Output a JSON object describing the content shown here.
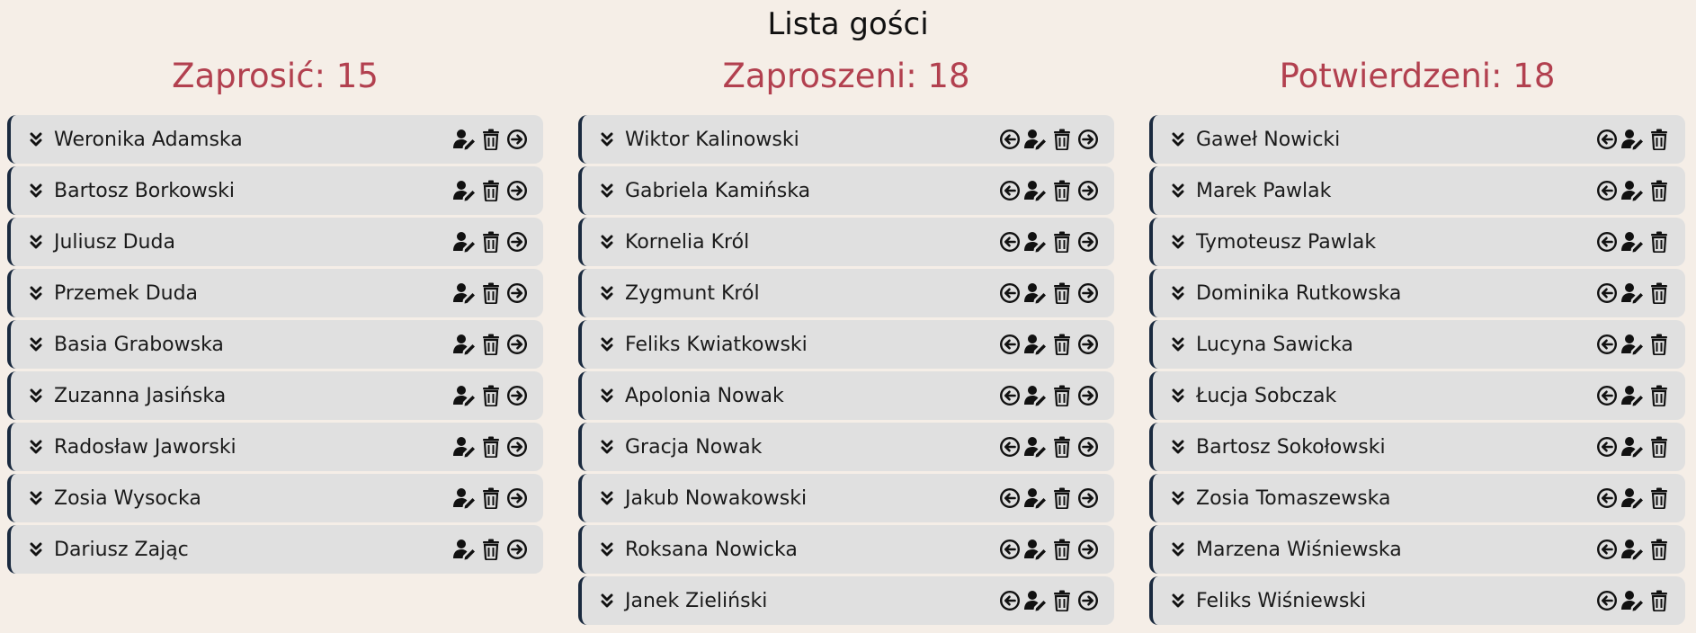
{
  "page": {
    "title": "Lista gości"
  },
  "columns": [
    {
      "title": "Zaprosić: 15",
      "actions": [
        "edit-user-icon",
        "trash-icon",
        "arrow-right-circle-icon"
      ],
      "guests": [
        "Weronika Adamska",
        "Bartosz Borkowski",
        "Juliusz Duda",
        "Przemek Duda",
        "Basia Grabowska",
        "Zuzanna Jasińska",
        "Radosław Jaworski",
        "Zosia Wysocka",
        "Dariusz Zając"
      ]
    },
    {
      "title": "Zaproszeni: 18",
      "actions": [
        "arrow-left-circle-icon",
        "edit-user-icon",
        "trash-icon",
        "arrow-right-circle-icon"
      ],
      "guests": [
        "Wiktor Kalinowski",
        "Gabriela Kamińska",
        "Kornelia Król",
        "Zygmunt Król",
        "Feliks Kwiatkowski",
        "Apolonia Nowak",
        "Gracja Nowak",
        "Jakub Nowakowski",
        "Roksana Nowicka",
        "Janek Zieliński"
      ]
    },
    {
      "title": "Potwierdzeni: 18",
      "actions": [
        "arrow-left-circle-icon",
        "edit-user-icon",
        "trash-icon"
      ],
      "guests": [
        "Gaweł Nowicki",
        "Marek Pawlak",
        "Tymoteusz Pawlak",
        "Dominika Rutkowska",
        "Lucyna Sawicka",
        "Łucja Sobczak",
        "Bartosz Sokołowski",
        "Zosia Tomaszewska",
        "Marzena Wiśniewska",
        "Feliks Wiśniewski"
      ]
    }
  ],
  "colors": {
    "background": "#f5eee7",
    "accent": "#b2404f",
    "item_background": "#e0e0e0",
    "item_border": "#1a2a3f",
    "icon": "#111111"
  }
}
